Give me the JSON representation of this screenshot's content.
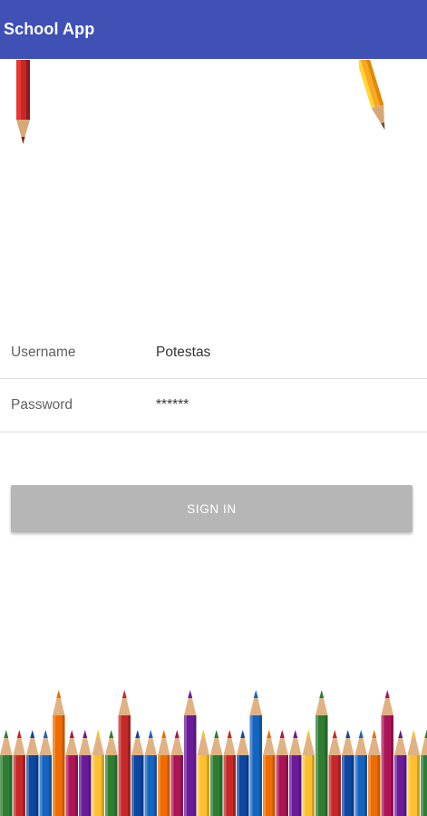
{
  "appbar": {
    "title": "School App",
    "color": "#3f51b5"
  },
  "login": {
    "username_label": "Username",
    "username_value": "Potestas",
    "password_label": "Password",
    "password_value": "******",
    "signin_label": "SIGN IN"
  },
  "decor": {
    "top_pencils": [
      {
        "icon": "red-pencil-icon",
        "color": "#c62828"
      },
      {
        "icon": "yellow-pencil-icon",
        "color": "#f9a825"
      }
    ],
    "bottom_pencil_colors": [
      "#2e7d32",
      "#1565c0",
      "#6a1b9a",
      "#c62828",
      "#ef6c00",
      "#fbc02d",
      "#0d47a1",
      "#ad1457"
    ]
  }
}
